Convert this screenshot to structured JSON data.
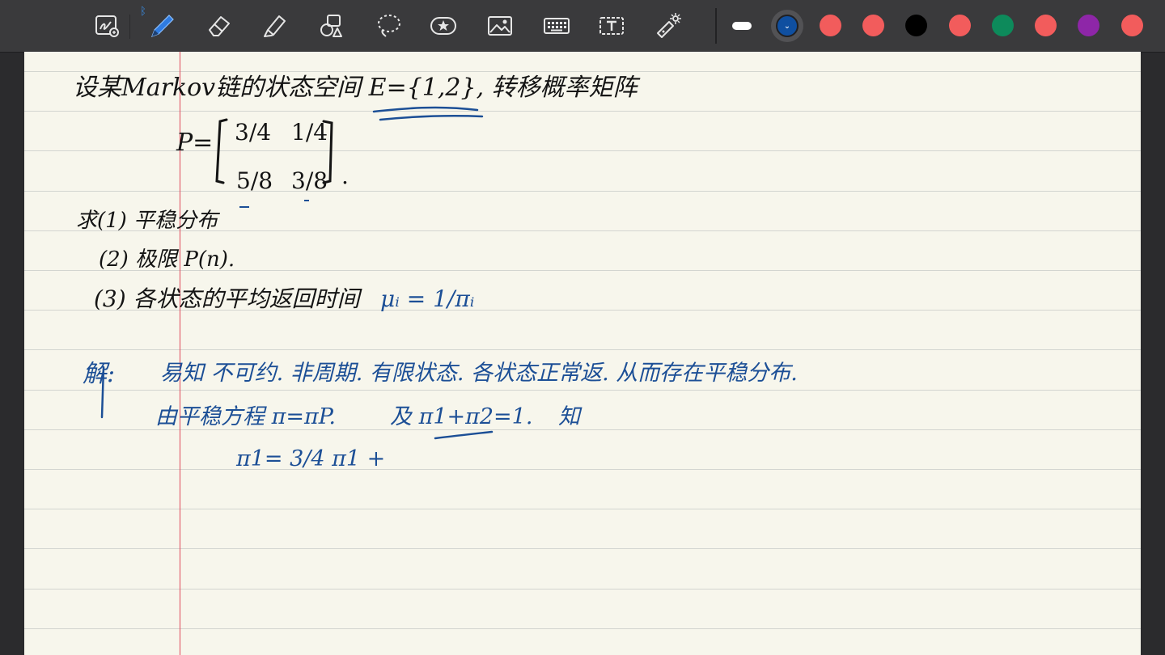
{
  "toolbar": {
    "tools": [
      {
        "name": "zoom-lasso-tool",
        "icon": "zoom-box-icon"
      },
      {
        "name": "pen-tool",
        "icon": "pen-icon",
        "active": true
      },
      {
        "name": "eraser-tool",
        "icon": "eraser-icon"
      },
      {
        "name": "highlighter-tool",
        "icon": "highlighter-icon"
      },
      {
        "name": "shapes-tool",
        "icon": "shapes-icon"
      },
      {
        "name": "lasso-tool",
        "icon": "lasso-icon"
      },
      {
        "name": "sticker-tool",
        "icon": "star-sticker-icon"
      },
      {
        "name": "image-tool",
        "icon": "image-icon"
      },
      {
        "name": "keyboard-tool",
        "icon": "keyboard-icon"
      },
      {
        "name": "text-tool",
        "icon": "text-box-icon"
      },
      {
        "name": "laser-tool",
        "icon": "laser-pointer-icon"
      }
    ],
    "bluetooth_glyph": "ᛒ",
    "dropdown_glyph": "⌄",
    "colors": [
      "#0f4fa0",
      "#f25c5c",
      "#f25c5c",
      "#000000",
      "#f25c5c",
      "#0d8a5b",
      "#f25c5c",
      "#8e26a8",
      "#f25c5c"
    ],
    "selected_color_index": 0
  },
  "note": {
    "paper_color": "#f7f6ec",
    "rule_color": "#d3d5d0",
    "margin_color": "#e04a5c",
    "ink_black": "#141414",
    "ink_blue": "#1c4f96",
    "problem": {
      "line1": "设某Markov链的状态空间 E={1,2}, 转移概率矩阵",
      "matrix_label": "P=",
      "m11": "3/4",
      "m12": "1/4",
      "m21": "5/8",
      "m22": "3/8",
      "matrix_end": ".",
      "ask": "求(1) 平稳分布",
      "ask2": "(2) 极限 P(n).",
      "ask3": "(3) 各状态的平均返回时间",
      "mu": "μᵢ = 1/πᵢ"
    },
    "solution": {
      "label": "解:",
      "line1": "易知 不可约. 非周期. 有限状态. 各状态正常返. 从而存在平稳分布.",
      "line2": "由平稳方程 π=πP.",
      "line2b": "及 π1+π2=1.",
      "line2c": "知",
      "line3": "π1= 3/4 π1 +"
    }
  }
}
